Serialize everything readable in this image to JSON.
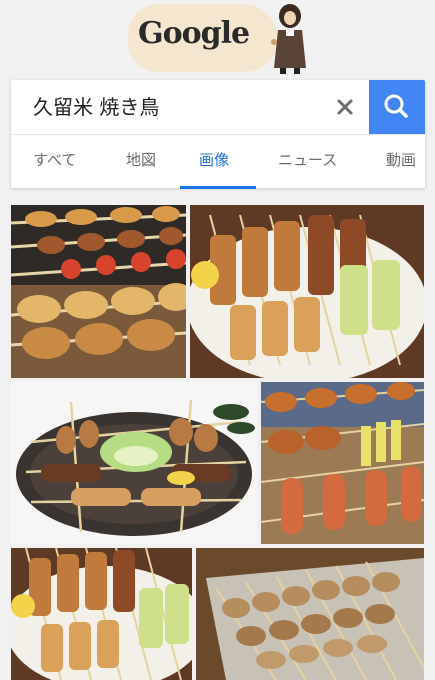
{
  "doodle": {
    "text": "Google"
  },
  "search": {
    "query": "久留米 焼き鳥"
  },
  "tabs": [
    {
      "label": "すべて"
    },
    {
      "label": "地図"
    },
    {
      "label": "画像"
    },
    {
      "label": "ニュース"
    },
    {
      "label": "動画"
    }
  ],
  "active_tab": "画像",
  "colors": {
    "accent": "#1a73e8",
    "search_button": "#4285f4",
    "doodle_bg": "#f4e6cf"
  },
  "icons": {
    "clear": "close-icon",
    "search": "search-icon"
  },
  "results": [
    {
      "name": "result-image-1"
    },
    {
      "name": "result-image-2"
    },
    {
      "name": "result-image-3"
    },
    {
      "name": "result-image-4"
    },
    {
      "name": "result-image-5"
    },
    {
      "name": "result-image-6"
    }
  ]
}
